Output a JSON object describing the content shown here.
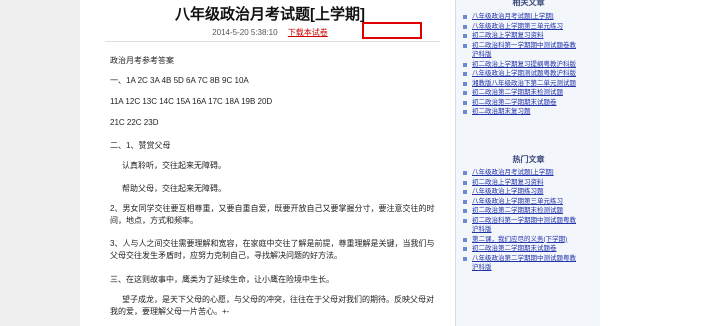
{
  "article": {
    "title": "八年级政治月考试题[上学期]",
    "date": "2014-5-20 5:38:10",
    "download_label": "下载本试卷",
    "lines": [
      "政治月考参考答案",
      "一、1A 2C 3A 4B 5D 6A 7C 8B 9C 10A",
      "11A 12C 13C 14C 15A 16A 17C 18A 19B 20D",
      "21C 22C 23D",
      "二、1、赞赏父母",
      "认真聆听，交往起来无障碍。",
      "帮助父母，交往起来无障碍。",
      "2、男女同学交往要互相尊重，又要自重自爱，既要开放自己又要掌握分寸，要注意交往的时间，地点，方式和频率。",
      "3、人与人之间交往需要理解和宽容，在家庭中交往了解是前提，尊重理解是关键，当我们与父母交往发生矛盾时，应努力克制自己，寻找解决问题的好方法。",
      "三、在这则故事中，鹰类为了延续生命，让小鹰在险境中生长。",
      "望子成龙，是天下父母的心愿，与父母的冲突，往往在于父母对我们的期待。反映父母对我的爱，要理解父母一片苦心。+-"
    ]
  },
  "sidebar": {
    "section1_title": "相关文章",
    "section1_items": [
      "八年级政治月考试题[上学期]",
      "八年级政治上学期第三单元练习",
      "初二政治上学期复习资料",
      "初二政治科第一学期期中测试题卷教",
      "沪科版",
      "初二政治上学期复习提纲粤教沪科版",
      "八年级政治上学期测试题粤教沪科版",
      "湘教版八年级政治下第二单元测试题",
      "初二政治第二学期期末检测试题",
      "初二政治第二学期期末试题卷",
      "初二政治期末复习题"
    ],
    "section2_title": "热门文章",
    "section2_items": [
      "八年级政治月考试题[上学期]",
      "初二政治上学期复习资料",
      "八年级政治上学期练习题",
      "八年级政治上学期第三单元练习",
      "初二政治第二学期期末检测试题",
      "初二政治科第一学期期中测试题粤教",
      "沪科版",
      "第二课，我们应尽的义务(下学期)",
      "初二政治第二学期期末试题卷",
      "八年级政治第二学期期中测试题粤教",
      "沪科版"
    ]
  }
}
